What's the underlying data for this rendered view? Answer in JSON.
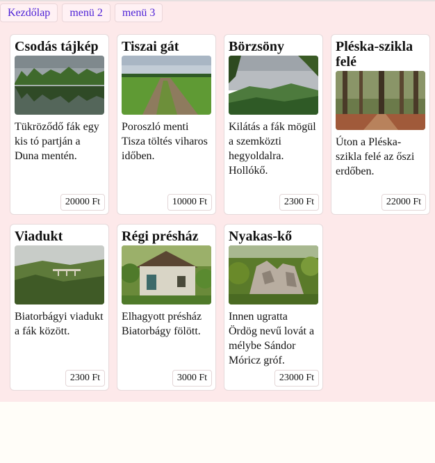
{
  "menu": {
    "items": [
      {
        "label": "Kezdőlap"
      },
      {
        "label": "menü 2"
      },
      {
        "label": "menü 3"
      }
    ]
  },
  "cards": [
    {
      "title": "Csodás tájkép",
      "description": "Tükröződő fák egy kis tó partján a Duna mentén.",
      "price": "20000 Ft",
      "image": "lake-with-tree-reflections"
    },
    {
      "title": "Tiszai gát",
      "description": "Poroszló menti Tisza töltés viharos időben.",
      "price": "10000 Ft",
      "image": "dirt-road-on-levee"
    },
    {
      "title": "Börzsöny",
      "description": "Kilátás a fák mögül a szemközti hegyoldalra. Hollókő.",
      "price": "2300 Ft",
      "image": "mountain-view"
    },
    {
      "title": "Pléska-szikla felé",
      "description": "Úton a Pléska-szikla felé az őszi erdőben.",
      "price": "22000 Ft",
      "image": "autumn-forest"
    },
    {
      "title": "Viadukt",
      "description": "Biatorbágyi viadukt a fák között.",
      "price": "2300 Ft",
      "image": "forested-valley-viaduct"
    },
    {
      "title": "Régi présház",
      "description": "Elhagyott présház Biatorbágy fölött.",
      "price": "3000 Ft",
      "image": "old-press-house"
    },
    {
      "title": "Nyakas-kő",
      "description": "Innen ugratta Ördög nevű lovát a mélybe Sándor Móricz gróf.",
      "price": "23000 Ft",
      "image": "rock-formation"
    }
  ]
}
